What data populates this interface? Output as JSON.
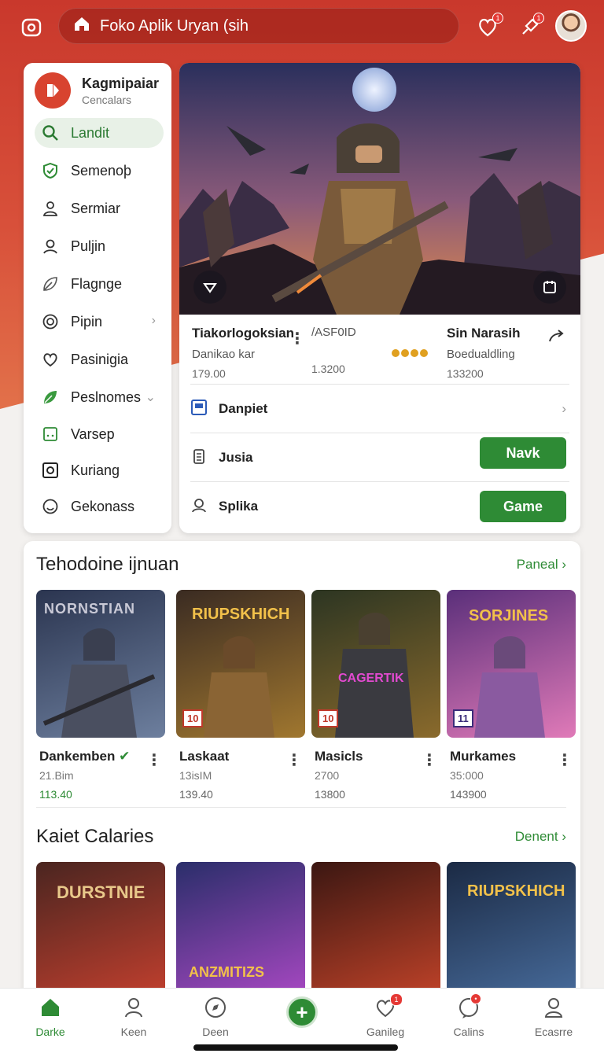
{
  "topbar": {
    "search_text": "Foko Aplik Uryan (sih",
    "notif_badge": "1",
    "alert_badge": "1"
  },
  "sidebar": {
    "brand_name": "Kagmipaiar",
    "brand_sub": "Cencalars",
    "items": [
      {
        "label": "Landit",
        "icon": "search-icon",
        "active": true
      },
      {
        "label": "Semenoþ",
        "icon": "shield-check-icon"
      },
      {
        "label": "Sermiar",
        "icon": "user-icon"
      },
      {
        "label": "Puljin",
        "icon": "people-icon"
      },
      {
        "label": "Flagnge",
        "icon": "leaf-icon"
      },
      {
        "label": "Pipin",
        "icon": "target-icon",
        "chevron": "›"
      },
      {
        "label": "Pasinigia",
        "icon": "heart-icon"
      },
      {
        "label": "Peslnomes",
        "icon": "leaf-filled-icon",
        "chevron": "⌄"
      },
      {
        "label": "Varsep",
        "icon": "dice-icon"
      },
      {
        "label": "Kuriang",
        "icon": "square-icon"
      },
      {
        "label": "Gekonass",
        "icon": "smile-icon"
      }
    ]
  },
  "hero": {
    "stats": [
      {
        "title": "Tiakorlogoksian",
        "sub": "Danikao kar",
        "value": "179.00"
      },
      {
        "title": "/ASF0ID",
        "sub": "",
        "value": "1.3200"
      },
      {
        "title": "Sin Narasih",
        "sub": "Boedualdling",
        "value": "133200"
      }
    ],
    "rows": [
      {
        "label": "Danpiet",
        "icon": "calendar-icon"
      },
      {
        "label": "Jusia",
        "icon": "battery-icon",
        "button": "Navk"
      },
      {
        "label": "Splika",
        "icon": "user-circle-icon",
        "button": "Game"
      }
    ]
  },
  "section1": {
    "title": "Tehodoine ijnuan",
    "link": "Paneal",
    "games": [
      {
        "thumb_text": "NORNSTIAN",
        "title": "Dankemben",
        "sub": "21.Bim",
        "value": "113.40",
        "green": true,
        "badge": "",
        "colors": [
          "#2b3550",
          "#6d7f9e"
        ]
      },
      {
        "thumb_text": "RIUPSKHICH",
        "title": "Laskaat",
        "sub": "13isIM",
        "value": "139.40",
        "green": false,
        "badge": "10",
        "colors": [
          "#3a2b22",
          "#a0772f"
        ]
      },
      {
        "thumb_text": "CAGERTIK",
        "title": "Masicls",
        "sub": "2700",
        "value": "13800",
        "green": false,
        "badge": "10",
        "colors": [
          "#2c3522",
          "#8a6a2c"
        ]
      },
      {
        "thumb_text": "SORJINES",
        "title": "Murkames",
        "sub": "35:000",
        "value": "143900",
        "green": false,
        "badge": "11",
        "colors": [
          "#5a2f7a",
          "#e07ab8"
        ]
      }
    ]
  },
  "section2": {
    "title": "Kaiet Calaries",
    "link": "Denent",
    "games": [
      {
        "thumb_text": "DURSTNIE",
        "colors": [
          "#4a2520",
          "#c9412f"
        ]
      },
      {
        "thumb_text": "ANZMITIZS",
        "colors": [
          "#2a2e6a",
          "#b04ac8"
        ]
      },
      {
        "thumb_text": "",
        "colors": [
          "#3b1712",
          "#c8452a"
        ]
      },
      {
        "thumb_text": "RIUPSKHICH",
        "colors": [
          "#1b2a44",
          "#4a6fa0"
        ]
      }
    ]
  },
  "bottomnav": [
    {
      "label": "Darke",
      "icon": "home-icon",
      "active": true
    },
    {
      "label": "Keen",
      "icon": "person-icon"
    },
    {
      "label": "Deen",
      "icon": "compass-icon"
    },
    {
      "label": "",
      "icon": "plus-icon"
    },
    {
      "label": "Ganileg",
      "icon": "heart-icon",
      "badge": "1"
    },
    {
      "label": "Calins",
      "icon": "chat-icon",
      "badge": "•"
    },
    {
      "label": "Ecasrre",
      "icon": "profile-icon"
    }
  ]
}
